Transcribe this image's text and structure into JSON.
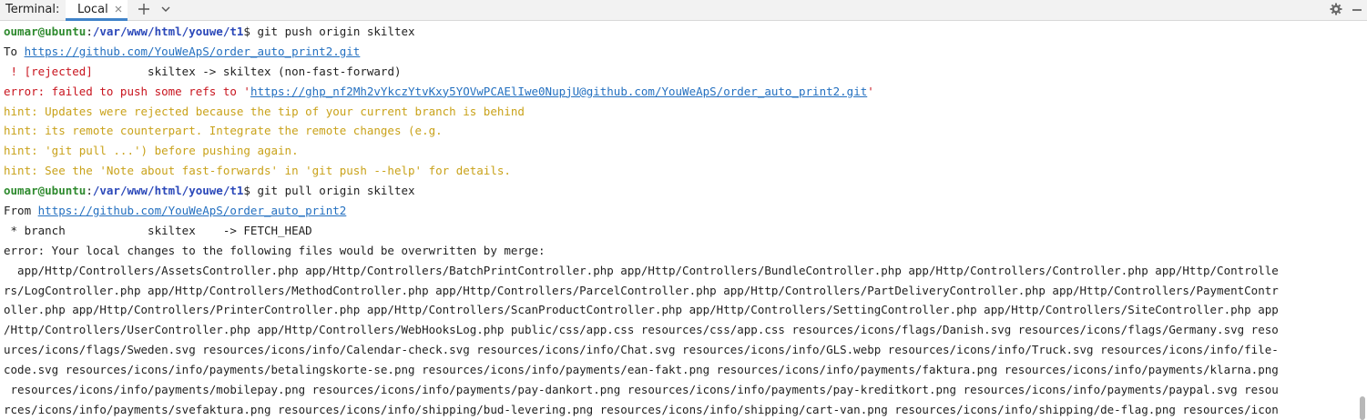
{
  "toolwindow": {
    "title": "Terminal:",
    "tabs": [
      {
        "label": "Local",
        "active": true
      }
    ]
  },
  "colors": {
    "user": "#2e8a2e",
    "path": "#2b48b9",
    "link": "#2470c0",
    "error": "#c8141e",
    "hint": "#c9a21a",
    "tab_underline": "#4083c9"
  },
  "terminal": {
    "push": {
      "user": "oumar@ubuntu",
      "colon": ":",
      "path": "/var/www/html/youwe/t1",
      "command": "$ git push origin skiltex",
      "to_prefix": "To ",
      "to_url": "https://github.com/YouWeApS/order_auto_print2.git",
      "rejected_marker": " ! [rejected]",
      "rejected_rest": "        skiltex -> skiltex (non-fast-forward)",
      "error_prefix": "error: failed to push some refs to '",
      "error_url": "https://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@github.com/YouWeApS/order_auto_print2.git",
      "error_suffix": "'",
      "hints": [
        "hint: Updates were rejected because the tip of your current branch is behind",
        "hint: its remote counterpart. Integrate the remote changes (e.g.",
        "hint: 'git pull ...') before pushing again.",
        "hint: See the 'Note about fast-forwards' in 'git push --help' for details."
      ]
    },
    "pull": {
      "user": "oumar@ubuntu",
      "colon": ":",
      "path": "/var/www/html/youwe/t1",
      "command": "$ git pull origin skiltex",
      "from_prefix": "From ",
      "from_url": "https://github.com/YouWeApS/order_auto_print2",
      "branch_line": " * branch            skiltex    -> FETCH_HEAD",
      "error_line": "error: Your local changes to the following files would be overwritten by merge:",
      "files_lines": [
        "  app/Http/Controllers/AssetsController.php app/Http/Controllers/BatchPrintController.php app/Http/Controllers/BundleController.php app/Http/Controllers/Controller.php app/Http/Controlle",
        "rs/LogController.php app/Http/Controllers/MethodController.php app/Http/Controllers/ParcelController.php app/Http/Controllers/PartDeliveryController.php app/Http/Controllers/PaymentContr",
        "oller.php app/Http/Controllers/PrinterController.php app/Http/Controllers/ScanProductController.php app/Http/Controllers/SettingController.php app/Http/Controllers/SiteController.php app",
        "/Http/Controllers/UserController.php app/Http/Controllers/WebHooksLog.php public/css/app.css resources/css/app.css resources/icons/flags/Danish.svg resources/icons/flags/Germany.svg reso",
        "urces/icons/flags/Sweden.svg resources/icons/info/Calendar-check.svg resources/icons/info/Chat.svg resources/icons/info/GLS.webp resources/icons/info/Truck.svg resources/icons/info/file-",
        "code.svg resources/icons/info/payments/betalingskorte-se.png resources/icons/info/payments/ean-fakt.png resources/icons/info/payments/faktura.png resources/icons/info/payments/klarna.png",
        " resources/icons/info/payments/mobilepay.png resources/icons/info/payments/pay-dankort.png resources/icons/info/payments/pay-kreditkort.png resources/icons/info/payments/paypal.svg resou",
        "rces/icons/info/payments/svefaktura.png resources/icons/info/shipping/bud-levering.png resources/icons/info/shipping/cart-van.png resources/icons/info/shipping/de-flag.png resources/icon"
      ]
    }
  }
}
